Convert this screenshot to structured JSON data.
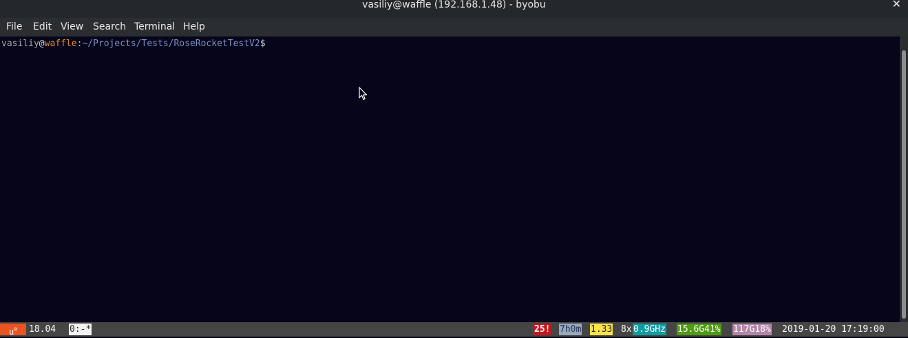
{
  "window": {
    "title": "vasiliy@waffle (192.168.1.48) - byobu",
    "close_glyph": "✕"
  },
  "menu": {
    "items": [
      "File",
      "Edit",
      "View",
      "Search",
      "Terminal",
      "Help"
    ]
  },
  "terminal": {
    "prompt": {
      "user": "vasiliy",
      "at": "@",
      "host": "waffle",
      "colon": ":",
      "path": "~/Projects/Tests/RoseRocketTestV2",
      "symbol": "$"
    },
    "colors": {
      "background": "#06051a",
      "host": "#e8892e",
      "path": "#7d8fc4"
    }
  },
  "statusbar": {
    "logo": "u",
    "release": "18.04",
    "window_tab": "0:-*",
    "updates": "25!",
    "uptime": "7h0m",
    "load": "1.33",
    "cpu_prefix": "8x",
    "cpu_freq": "0.9GHz",
    "memory": "15.6G41%",
    "disk": "117G18%",
    "datetime": "2019-01-20 17:19:00",
    "colors": {
      "logo": "#e95420",
      "updates": "#c7161c",
      "uptime": "#95aabd",
      "load": "#ffe34a",
      "cpu": "#0f9ca1",
      "memory": "#4f9b12",
      "disk": "#b386a8"
    }
  }
}
